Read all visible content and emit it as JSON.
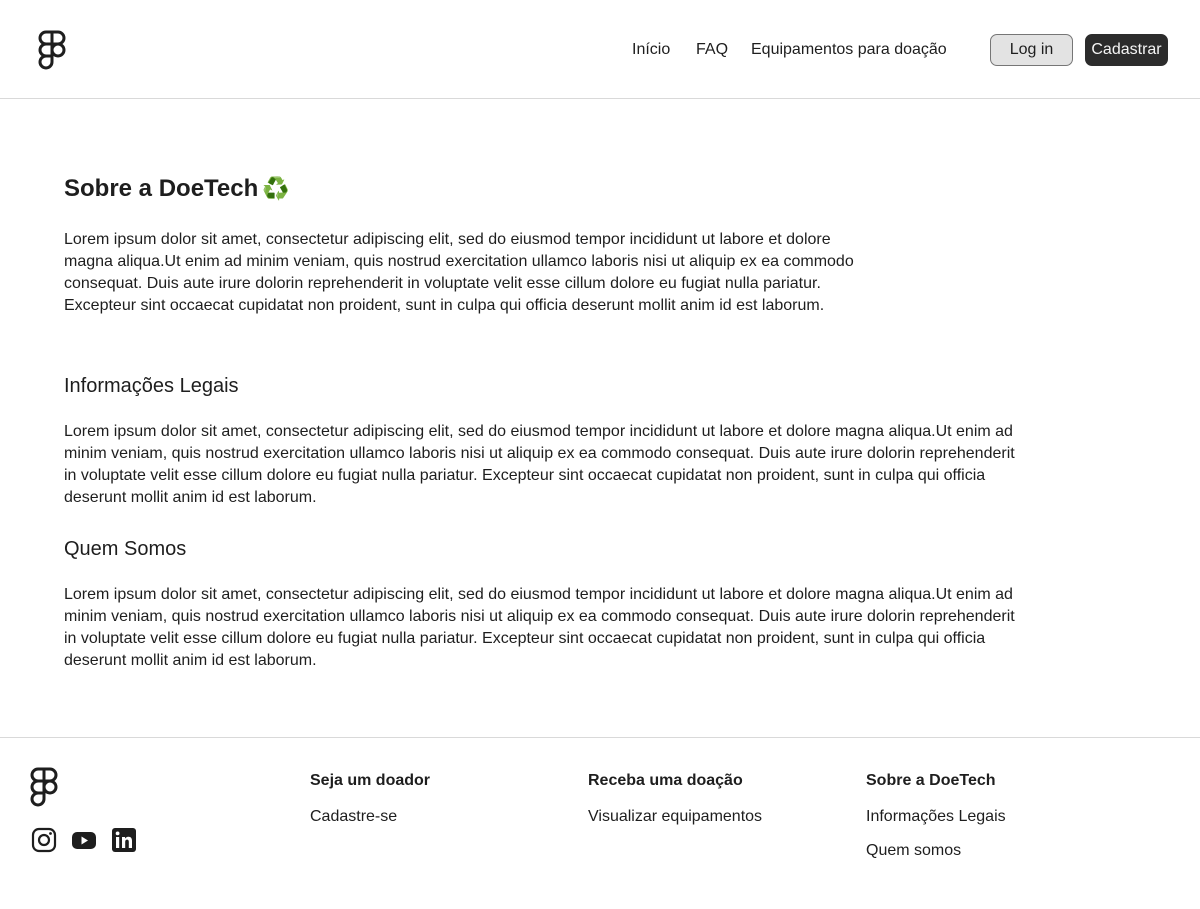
{
  "colors": {
    "primary_button": "#2c2c2c",
    "secondary_button": "#e3e3e3",
    "border": "#d9d9d9",
    "recycle": "#2e9e2e"
  },
  "header": {
    "logo_icon": "figma-logo-icon",
    "nav": [
      "Início",
      "FAQ",
      "Equipamentos para doação"
    ],
    "login_label": "Log in",
    "signup_label": "Cadastrar"
  },
  "main": {
    "title": "Sobre a DoeTech",
    "title_emoji": "♻️",
    "intro": "Lorem ipsum dolor sit amet, consectetur adipiscing elit, sed do eiusmod tempor incididunt ut labore et dolore magna aliqua.Ut enim ad minim veniam, quis nostrud exercitation ullamco laboris nisi ut aliquip ex ea commodo consequat. Duis aute irure dolorin reprehenderit in voluptate velit esse cillum dolore eu fugiat nulla pariatur. Excepteur sint occaecat cupidatat non proident, sunt in culpa qui officia deserunt mollit anim id est laborum.",
    "legal_title": "Informações Legais",
    "legal_text": "Lorem ipsum dolor sit amet, consectetur adipiscing elit, sed do eiusmod tempor incididunt ut labore et dolore magna aliqua.Ut enim ad minim veniam, quis nostrud exercitation ullamco laboris nisi ut aliquip ex ea commodo consequat. Duis aute irure dolorin reprehenderit in voluptate velit esse cillum dolore eu fugiat nulla pariatur. Excepteur sint occaecat cupidatat non proident, sunt in culpa qui officia deserunt mollit anim id est laborum.",
    "about_title": "Quem Somos",
    "about_text": "Lorem ipsum dolor sit amet, consectetur adipiscing elit, sed do eiusmod tempor incididunt ut labore et dolore magna aliqua.Ut enim ad minim veniam, quis nostrud exercitation ullamco laboris nisi ut aliquip ex ea commodo consequat. Duis aute irure dolorin reprehenderit in voluptate velit esse cillum dolore eu fugiat nulla pariatur. Excepteur sint occaecat cupidatat non proident, sunt in culpa qui officia deserunt mollit anim id est laborum."
  },
  "footer": {
    "logo_icon": "figma-logo-icon",
    "social": [
      "instagram-icon",
      "youtube-icon",
      "linkedin-icon"
    ],
    "columns": [
      {
        "title": "Seja um doador",
        "links": [
          "Cadastre-se"
        ]
      },
      {
        "title": "Receba uma doação",
        "links": [
          "Visualizar equipamentos"
        ]
      },
      {
        "title": "Sobre a DoeTech",
        "links": [
          "Informações Legais",
          "Quem somos"
        ]
      }
    ]
  }
}
